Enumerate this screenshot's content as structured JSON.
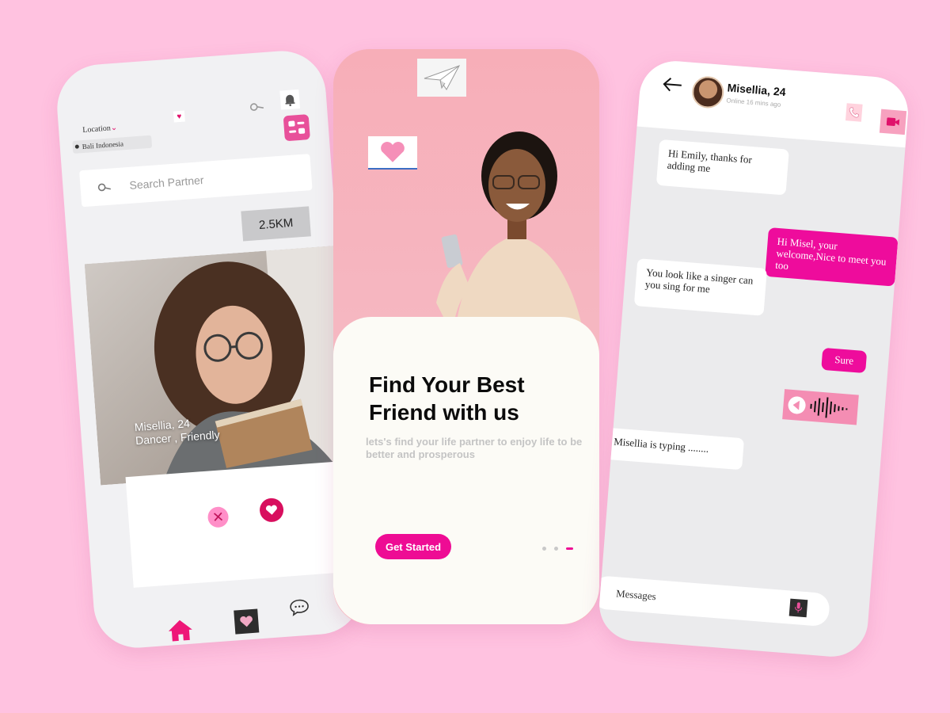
{
  "discover": {
    "location_label": "Location",
    "location_value": "Bali Indonesia",
    "search_placeholder": "Search Partner",
    "distance": "2.5KM",
    "profile_name": "Misellia, 24",
    "profile_tags": "Dancer , Friendly"
  },
  "onboarding": {
    "title": "Find Your Best Friend with us",
    "subtitle": "lets's find your life partner to enjoy life  to be better and prosperous",
    "cta": "Get Started",
    "pages": 3,
    "active_page": 3
  },
  "chat": {
    "contact_name": "Misellia, 24",
    "status": "Online 16 mins ago",
    "messages": [
      {
        "from": "them",
        "text": "Hi Emily, thanks for adding me"
      },
      {
        "from": "me",
        "text": "Hi Misel, your welcome,Nice to meet you too"
      },
      {
        "from": "them",
        "text": "You look like a singer can you sing for me"
      },
      {
        "from": "me",
        "text": "Sure"
      },
      {
        "from": "them",
        "text": "Misellia is typing ........"
      }
    ],
    "input_placeholder": "Messages"
  },
  "colors": {
    "background": "#ffc2e0",
    "accent": "#ee0c94",
    "like": "#d80f5e",
    "dislike": "#ff8fc8"
  },
  "icons": [
    "key-search-icon",
    "bell-icon",
    "filter-icon",
    "search-icon",
    "heart-icon",
    "close-icon",
    "home-icon",
    "chat-bubble-icon",
    "paper-plane-icon",
    "back-arrow-icon",
    "phone-icon",
    "video-icon",
    "play-icon",
    "microphone-icon"
  ]
}
